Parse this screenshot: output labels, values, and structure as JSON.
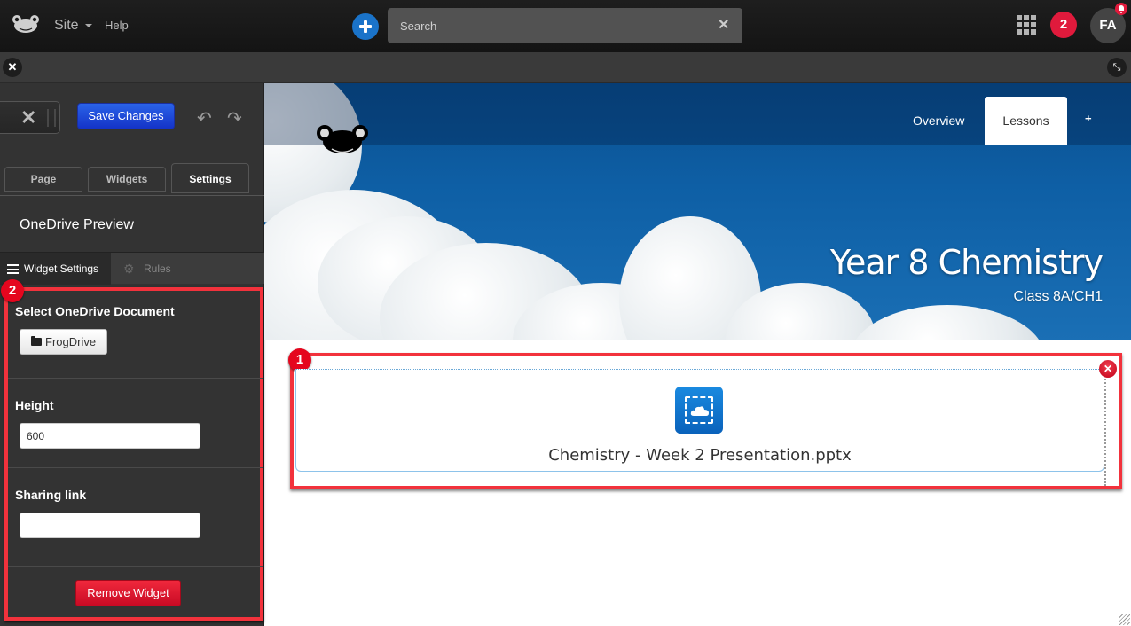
{
  "topbar": {
    "site_label": "Site",
    "help_label": "Help",
    "search_placeholder": "Search",
    "search_clear": "✕",
    "notification_count": "2",
    "avatar_initials": "FA"
  },
  "editbar": {
    "close_glyph": "✕",
    "collapse_glyph": "⤡"
  },
  "sidebar": {
    "cancel_glyph": "✕",
    "save_label": "Save Changes",
    "undo_glyph": "↶",
    "redo_glyph": "↷",
    "tabs": [
      {
        "label": "Page"
      },
      {
        "label": "Widgets"
      },
      {
        "label": "Settings",
        "active": true
      }
    ],
    "widget_title": "OneDrive Preview",
    "subtabs": [
      {
        "label": "Widget Settings",
        "active": true
      },
      {
        "label": "Rules"
      }
    ],
    "sections": {
      "document_label": "Select OneDrive Document",
      "frogdrive_label": "FrogDrive",
      "height_label": "Height",
      "height_value": "600",
      "sharing_label": "Sharing link",
      "sharing_value": ""
    },
    "remove_label": "Remove Widget"
  },
  "hero": {
    "nav": [
      {
        "label": "Overview"
      },
      {
        "label": "Lessons",
        "active": true
      },
      {
        "label": "+"
      }
    ],
    "title": "Year 8 Chemistry",
    "subtitle": "Class 8A/CH1"
  },
  "widget": {
    "filename": "Chemistry - Week 2 Presentation.pptx",
    "close_glyph": "✕"
  },
  "annotations": {
    "badge1": "1",
    "badge2": "2",
    "color": "#f2323c"
  },
  "colors": {
    "brand_blue": "#1a73c9",
    "save_blue": "#1f4ad8",
    "danger_red": "#e01a3c"
  }
}
